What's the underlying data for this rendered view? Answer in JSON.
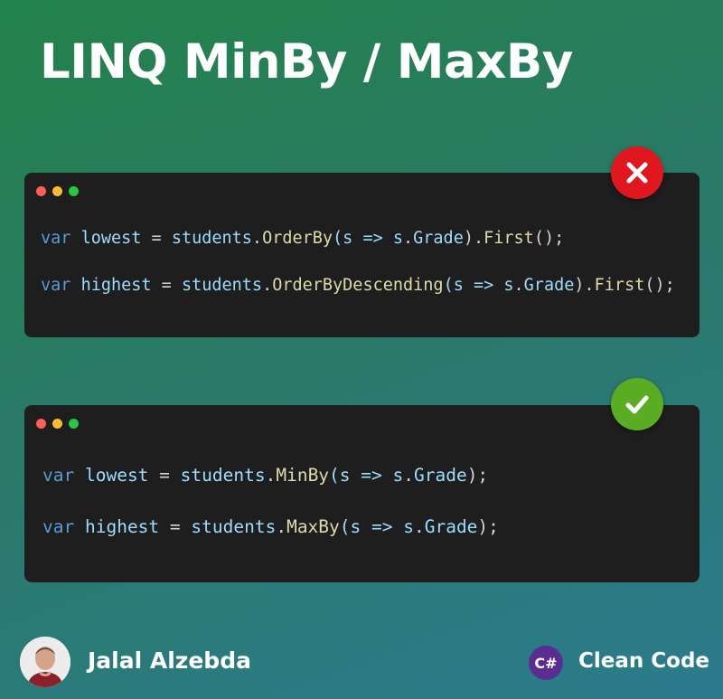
{
  "title": "LINQ MinBy / MaxBy",
  "bad_example": {
    "status_icon": "x-icon",
    "status_color": "#e0171f",
    "line1": {
      "kw": "var",
      "name": "lowest",
      "eq": " = ",
      "obj": "students",
      "dot1": ".",
      "method": "OrderBy",
      "args_open": "(s => s",
      "dot2": ".",
      "prop": "Grade",
      "args_close": ")",
      "dot3": ".",
      "method2": "First",
      "end": "();"
    },
    "line2": {
      "kw": "var",
      "name": "highest",
      "eq": " = ",
      "obj": "students",
      "dot1": ".",
      "method": "OrderByDescending",
      "args_open": "(s => s",
      "dot2": ".",
      "prop": "Grade",
      "args_close": ")",
      "dot3": ".",
      "method2": "First",
      "end": "();"
    }
  },
  "good_example": {
    "status_icon": "check-icon",
    "status_color": "#5aad22",
    "line1": {
      "kw": "var",
      "name": "lowest",
      "eq": " = ",
      "obj": "students",
      "dot1": ".",
      "method": "MinBy",
      "args_open": "(s => s",
      "dot2": ".",
      "prop": "Grade",
      "end": ");"
    },
    "line2": {
      "kw": "var",
      "name": "highest",
      "eq": " = ",
      "obj": "students",
      "dot1": ".",
      "method": "MaxBy",
      "args_open": "(s => s",
      "dot2": ".",
      "prop": "Grade",
      "end": ");"
    }
  },
  "window_dots": [
    "#ff5f57",
    "#febc2e",
    "#28c840"
  ],
  "footer": {
    "author": "Jalal Alzebda",
    "brand": "Clean Code",
    "brand_logo_text": "C#"
  }
}
